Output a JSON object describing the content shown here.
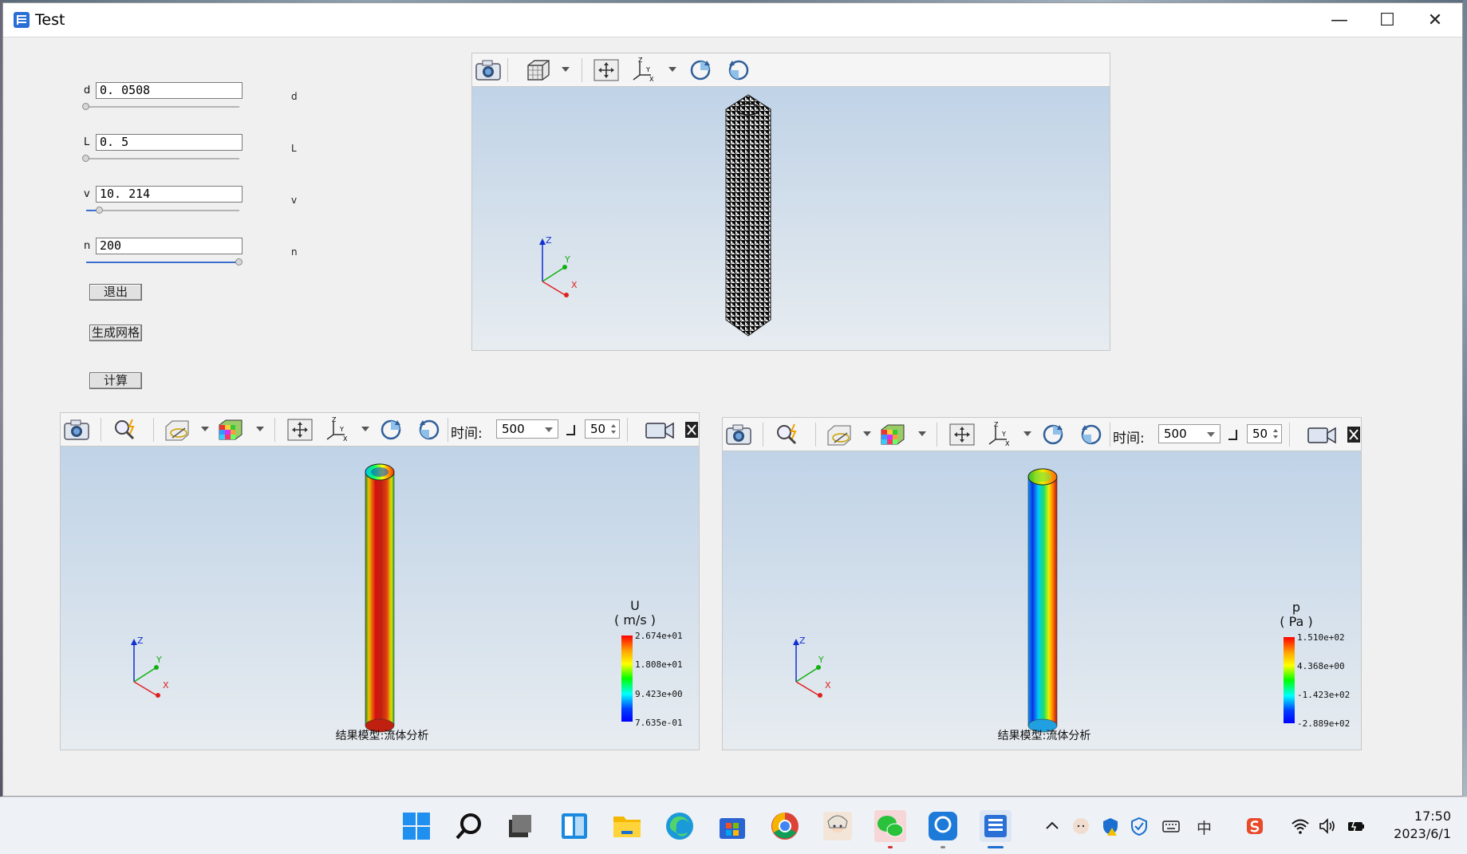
{
  "window": {
    "title": "Test",
    "minimize": "—",
    "maximize": "☐",
    "close": "✕"
  },
  "params": [
    {
      "label": "d",
      "value": "0. 0508",
      "aside": "d",
      "fraction": 0.0
    },
    {
      "label": "L",
      "value": "0. 5",
      "aside": "L",
      "fraction": 0.0
    },
    {
      "label": "v",
      "value": "10. 214",
      "aside": "v",
      "fraction": 0.09
    },
    {
      "label": "n",
      "value": "200",
      "aside": "n",
      "fraction": 1.0
    }
  ],
  "buttons": {
    "exit": "退出",
    "mesh": "生成网格",
    "compute": "计算"
  },
  "viewer_mesh": {
    "icons": [
      "camera-icon",
      "cube-view-icon",
      "fit-view-icon",
      "axes-icon",
      "rotate-cw-icon",
      "rotate-ccw-icon"
    ],
    "axis": {
      "z": "Z",
      "y": "Y",
      "x": "X"
    }
  },
  "viewer_u": {
    "time_label": "时间:",
    "time_value": "500",
    "step_value": "50",
    "legend_title": "U",
    "legend_unit": "( m/s )",
    "ticks": [
      "2.674e+01",
      "1.808e+01",
      "9.423e+00",
      "7.635e-01"
    ],
    "caption": "结果模型:流体分析",
    "axis": {
      "z": "Z",
      "y": "Y",
      "x": "X"
    }
  },
  "viewer_p": {
    "time_label": "时间:",
    "time_value": "500",
    "step_value": "50",
    "legend_title": "p",
    "legend_unit": "( Pa )",
    "ticks": [
      "1.510e+02",
      "4.368e+00",
      "-1.423e+02",
      "-2.889e+02"
    ],
    "caption": "结果模型:流体分析",
    "axis": {
      "z": "Z",
      "y": "Y",
      "x": "X"
    }
  },
  "taskbar": {
    "apps": [
      "start-icon",
      "search-icon",
      "task-view-icon",
      "widgets-icon",
      "file-explorer-icon",
      "edge-icon",
      "store-icon",
      "chrome-icon",
      "avatar-app-icon",
      "wechat-icon",
      "slindroid-icon",
      "test-app-icon"
    ],
    "clock_time": "17:50",
    "clock_date": "2023/6/1",
    "ime": "中"
  },
  "colors": {
    "accent": "#3a6fd0",
    "viewport_top": "#c0d3e7",
    "viewport_bottom": "#e7ecf0"
  }
}
